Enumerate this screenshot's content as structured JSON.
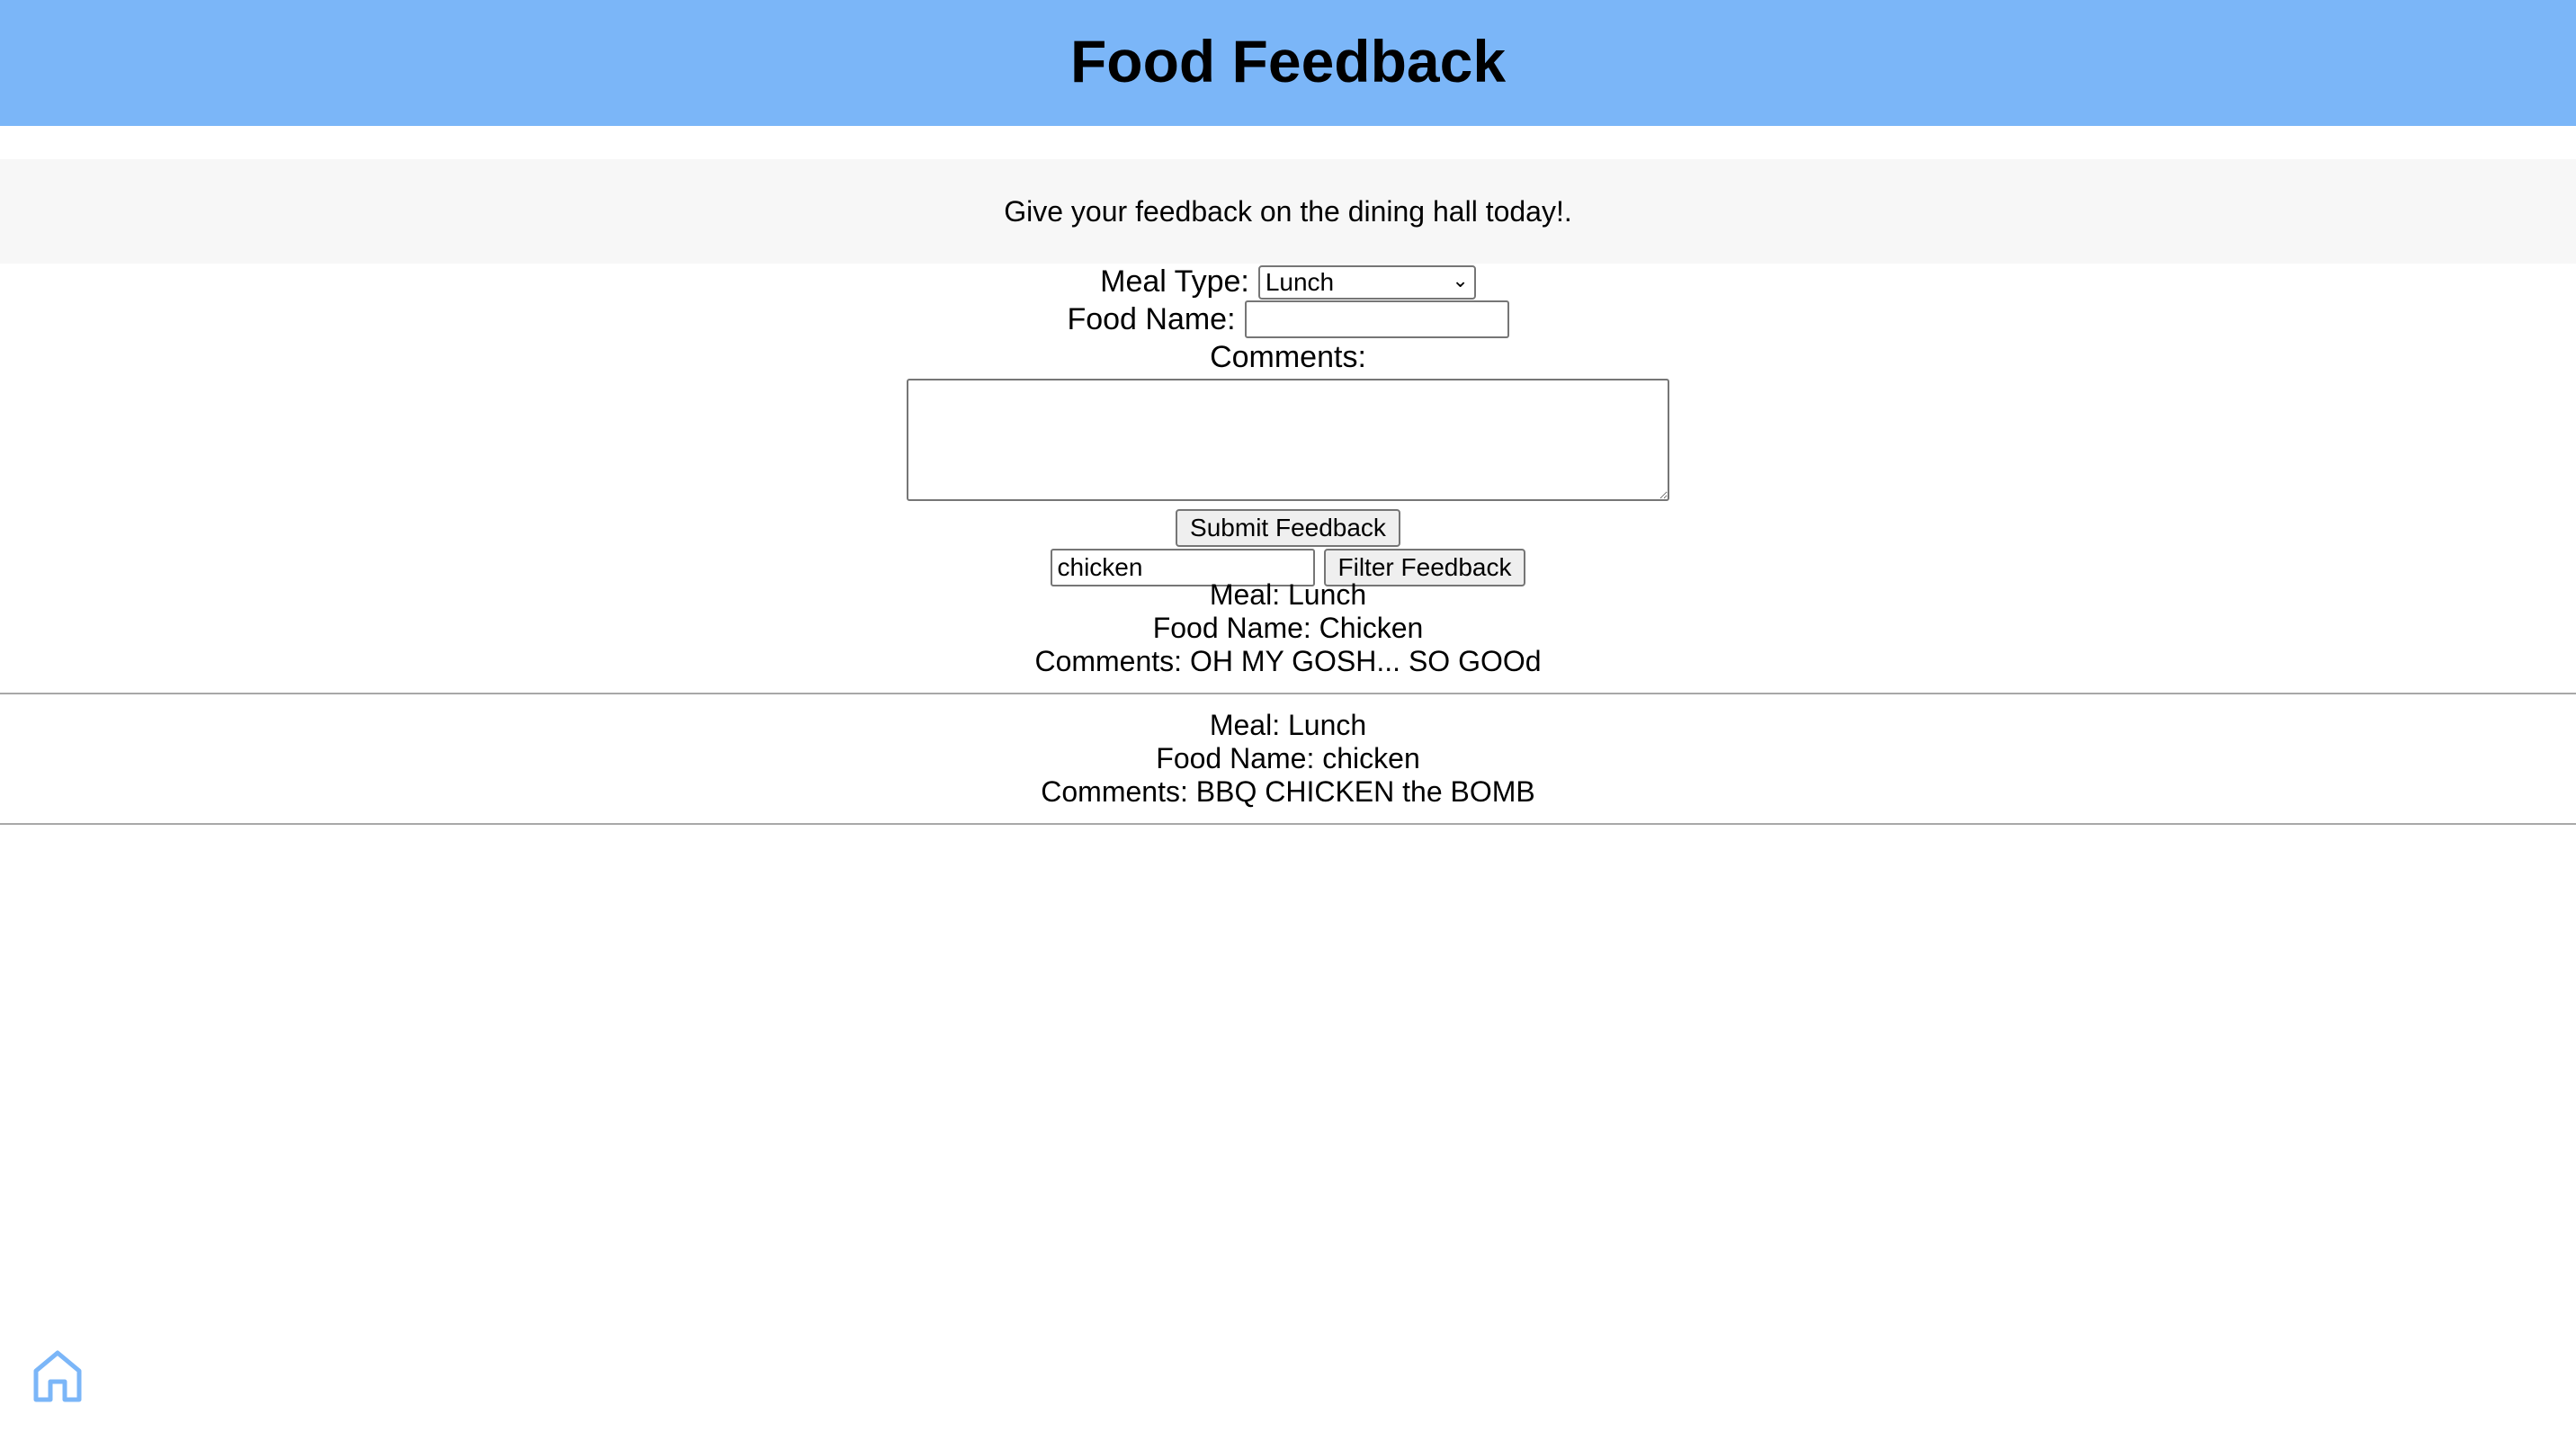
{
  "header": {
    "title": "Food Feedback"
  },
  "intro": {
    "text": "Give your feedback on the dining hall today!."
  },
  "form": {
    "meal_type_label": "Meal Type:",
    "meal_type_value": "Lunch",
    "food_name_label": "Food Name:",
    "food_name_value": "",
    "comments_label": "Comments:",
    "comments_value": "",
    "submit_label": "Submit Feedback"
  },
  "filter": {
    "value": "chicken",
    "button_label": "Filter Feedback"
  },
  "entries": [
    {
      "meal": "Meal: Lunch",
      "food": "Food Name: Chicken",
      "comments": "Comments: OH MY GOSH... SO GOOd"
    },
    {
      "meal": "Meal: Lunch",
      "food": "Food Name: chicken",
      "comments": "Comments: BBQ CHICKEN the BOMB"
    }
  ],
  "icons": {
    "home": "home-icon"
  },
  "colors": {
    "header_bg": "#7bb6f8",
    "home_icon": "#7bb6f8"
  }
}
